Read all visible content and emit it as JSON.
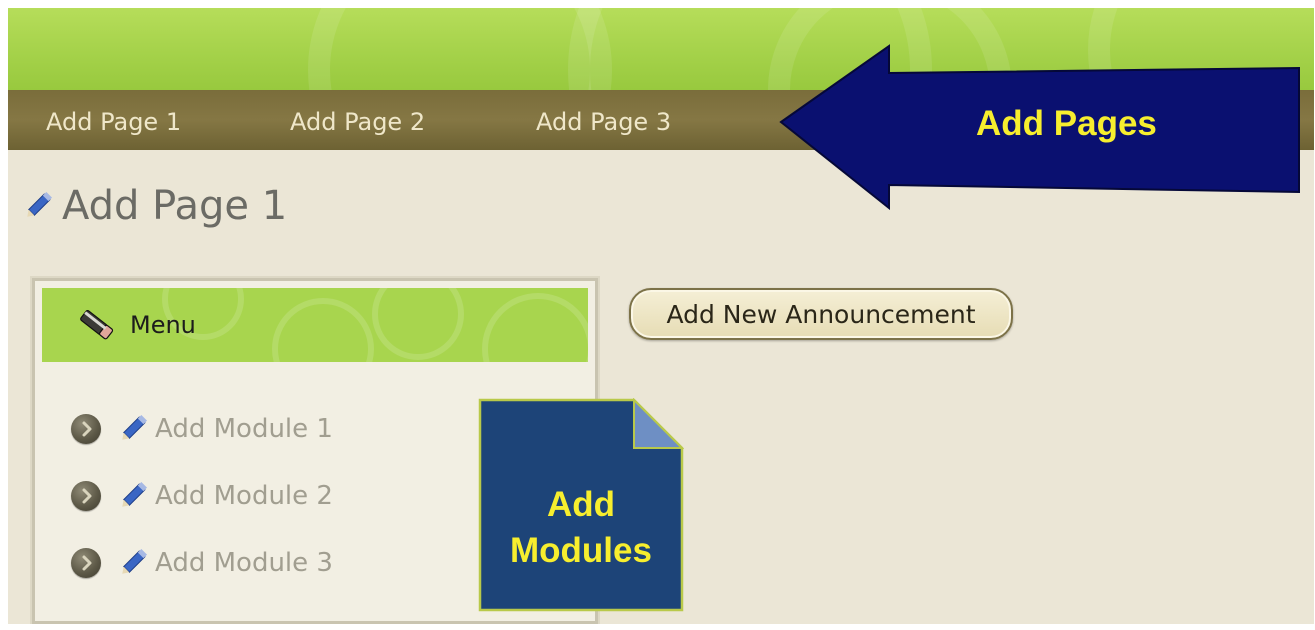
{
  "nav": {
    "items": [
      "Add Page 1",
      "Add Page 2",
      "Add Page 3"
    ]
  },
  "callouts": {
    "pages": "Add Pages",
    "modules_line1": "Add",
    "modules_line2": "Modules"
  },
  "page": {
    "title": "Add Page 1"
  },
  "menu": {
    "title": "Menu",
    "items": [
      "Add Module 1",
      "Add Module 2",
      "Add Module 3"
    ]
  },
  "actions": {
    "add_announcement": "Add New Announcement"
  },
  "colors": {
    "banner_green": "#a5d24a",
    "nav_olive": "#7a6d3b",
    "callout_navy": "#0a1070",
    "callout_blue": "#1d4478",
    "callout_text": "#f7ee2e",
    "page_bg": "#ebe6d6"
  },
  "icons": {
    "pencil": "pencil-icon",
    "bullet": "arrow-bullet-icon",
    "menu": "pencil-eraser-icon"
  }
}
